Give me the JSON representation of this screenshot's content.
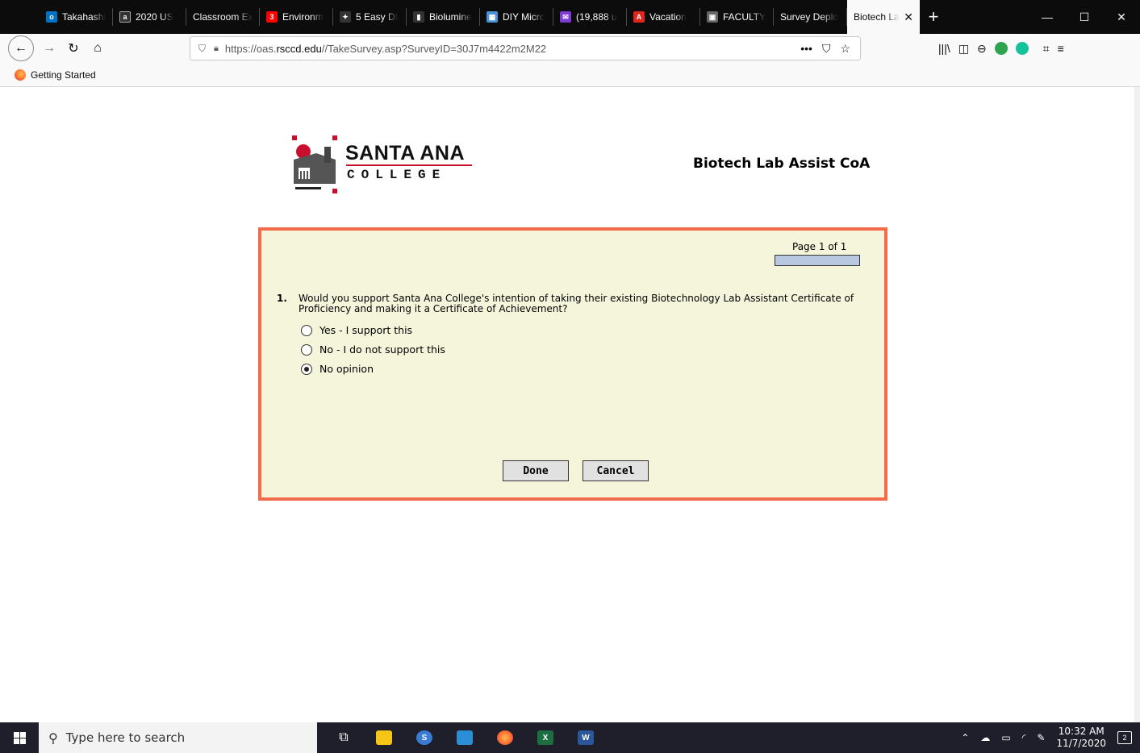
{
  "browser": {
    "tabs": [
      {
        "label": "Takahashi",
        "icon": "outlook-icon",
        "color": "#0072c6"
      },
      {
        "label": "2020 US",
        "icon": "abc-news-icon",
        "color": "#333333"
      },
      {
        "label": "Classroom Ex",
        "icon": "",
        "color": ""
      },
      {
        "label": "Environm",
        "icon": "3m-icon",
        "color": "#ff0000"
      },
      {
        "label": "5 Easy DI",
        "icon": "instructables-icon",
        "color": "#333333"
      },
      {
        "label": "Biolumine",
        "icon": "bookmark-icon",
        "color": "#333333"
      },
      {
        "label": "DIY Micro",
        "icon": "image-icon",
        "color": "#4a90d9"
      },
      {
        "label": "(19,888 u",
        "icon": "mail-icon",
        "color": "#7e3bcf"
      },
      {
        "label": "Vacation",
        "icon": "adobe-icon",
        "color": "#e1251b"
      },
      {
        "label": "FACULTY",
        "icon": "faculty-icon",
        "color": "#666666"
      },
      {
        "label": "Survey Deplo",
        "icon": "",
        "color": ""
      }
    ],
    "active_tab": {
      "label": "Biotech La"
    },
    "url": {
      "prefix": "https://oas.",
      "domain": "rsccd.edu",
      "path": "//TakeSurvey.asp?SurveyID=30J7m4422m2M22"
    },
    "bookmarks": [
      {
        "label": "Getting Started"
      }
    ]
  },
  "page": {
    "logo": {
      "line1": "SANTA ANA",
      "line2": "COLLEGE"
    },
    "survey_title": "Biotech Lab Assist CoA",
    "page_info": "Page 1 of 1",
    "progress_fraction": 1.0,
    "question": {
      "number": "1.",
      "text": "Would you support Santa Ana College's intention of taking their existing Biotechnology Lab Assistant Certificate of Proficiency and making it a Certificate of Achievement?",
      "options": [
        {
          "label": "Yes - I support this",
          "selected": false
        },
        {
          "label": "No - I do not support this",
          "selected": false
        },
        {
          "label": "No opinion",
          "selected": true
        }
      ]
    },
    "buttons": {
      "done": "Done",
      "cancel": "Cancel"
    },
    "border_color": "#f26b4a",
    "panel_color": "#f5f5dc"
  },
  "taskbar": {
    "search_placeholder": "Type here to search",
    "time": "10:32 AM",
    "date": "11/7/2020",
    "notification_count": "2"
  }
}
